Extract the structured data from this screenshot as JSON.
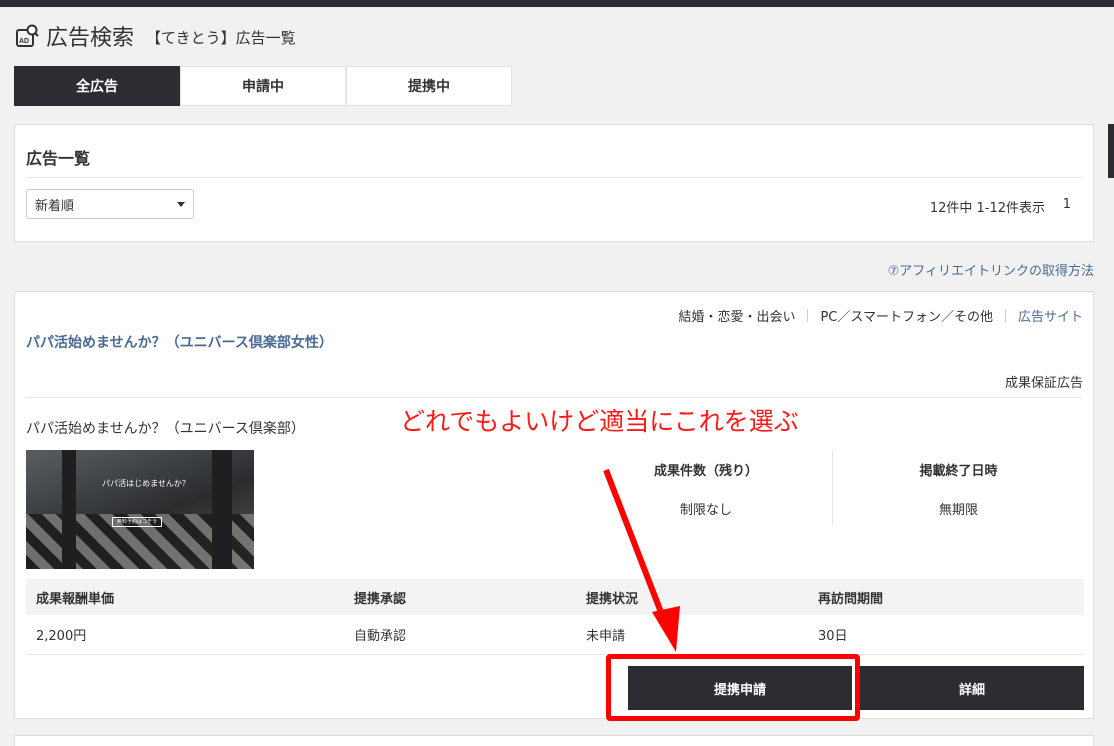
{
  "header": {
    "title": "広告検索",
    "subtitle": "【てきとう】広告一覧"
  },
  "tabs": [
    {
      "label": "全広告",
      "active": true
    },
    {
      "label": "申請中",
      "active": false
    },
    {
      "label": "提携中",
      "active": false
    }
  ],
  "list": {
    "heading": "広告一覧",
    "sort_value": "新着順",
    "result_count": "12件中 1-12件表示",
    "page": "1"
  },
  "help_link": "⑦アフィリエイトリンクの取得方法",
  "ad": {
    "categories": "結婚・恋愛・出会い",
    "devices": "PC／スマートフォン／その他",
    "site_link": "広告サイト",
    "title": "パパ活始めませんか？（ユニバース倶楽部女性）",
    "guarantee": "成果保証広告",
    "description": "パパ活始めませんか？（ユニバース倶楽部）",
    "thumbnail_text": "パパ活はじめませんか？",
    "thumbnail_button": "無料予約はコチラ",
    "stats": [
      {
        "label": "成果件数（残り）",
        "value": "制限なし"
      },
      {
        "label": "掲載終了日時",
        "value": "無期限"
      }
    ],
    "table_headers": [
      "成果報酬単価",
      "提携承認",
      "提携状況",
      "再訪問期間"
    ],
    "table_values": [
      "2,200円",
      "自動承認",
      "未申請",
      "30日"
    ],
    "apply_label": "提携申請",
    "detail_label": "詳細"
  },
  "annotation": "どれでもよいけど適当にこれを選ぶ",
  "colors": {
    "dark": "#2b2d33",
    "link": "#4a6a94",
    "annotation_red": "#ff0000"
  }
}
